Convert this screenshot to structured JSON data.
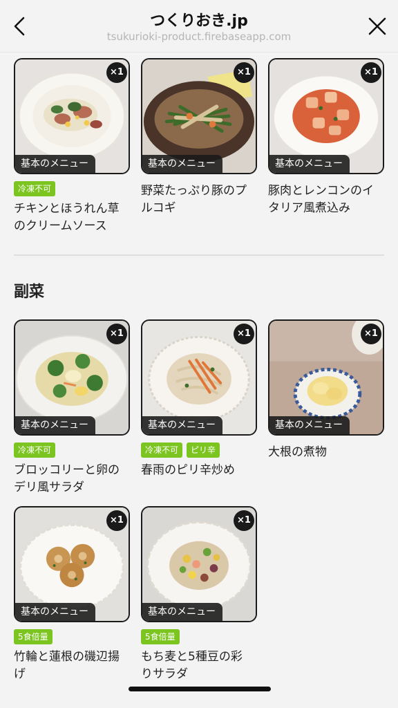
{
  "header": {
    "title": "つくりおき.jp",
    "url": "tsukurioki-product.firebaseapp.com"
  },
  "main_items": [
    {
      "qty": "×1",
      "label": "基本のメニュー",
      "tags": [
        "冷凍不可"
      ],
      "name_lines": [
        "チキンとほうれん草",
        "のクリームソース"
      ]
    },
    {
      "qty": "×1",
      "label": "基本のメニュー",
      "tags": [],
      "name_lines": [
        "野菜たっぷり豚のプ",
        "ルコギ"
      ]
    },
    {
      "qty": "×1",
      "label": "基本のメニュー",
      "tags": [],
      "name_lines": [
        "豚肉とレンコンのイ",
        "タリア風煮込み"
      ]
    }
  ],
  "side_section_title": "副菜",
  "side_items": [
    {
      "qty": "×1",
      "label": "基本のメニュー",
      "tags": [
        "冷凍不可"
      ],
      "name_lines": [
        "ブロッコリーと卵の",
        "デリ風サラダ"
      ]
    },
    {
      "qty": "×1",
      "label": "基本のメニュー",
      "tags": [
        "冷凍不可",
        "ピリ辛"
      ],
      "name_lines": [
        "春雨のピリ辛炒め"
      ]
    },
    {
      "qty": "×1",
      "label": "基本のメニュー",
      "tags": [],
      "name_lines": [
        "大根の煮物"
      ]
    },
    {
      "qty": "×1",
      "label": "基本のメニュー",
      "tags": [
        "5食倍量"
      ],
      "name_lines": [
        "竹輪と蓮根の磯辺揚",
        "げ"
      ]
    },
    {
      "qty": "×1",
      "label": "基本のメニュー",
      "tags": [
        "5食倍量"
      ],
      "name_lines": [
        "もち麦と5種豆の彩",
        "りサラダ"
      ]
    }
  ],
  "colors": {
    "tag_green": "#7cc520",
    "label_bg": "#1a1a1a",
    "background": "#f3f3f3"
  }
}
